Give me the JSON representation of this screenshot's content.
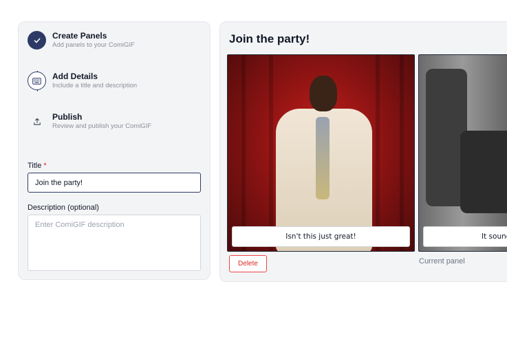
{
  "steps": [
    {
      "title": "Create Panels",
      "description": "Add panels to your ComiGIF",
      "icon": "check-icon",
      "state": "done"
    },
    {
      "title": "Add Details",
      "description": "Include a title and description",
      "icon": "keyboard-icon",
      "state": "current"
    },
    {
      "title": "Publish",
      "description": "Review and publish your ComiGIF",
      "icon": "upload-icon",
      "state": "todo"
    }
  ],
  "form": {
    "title_label": "Title",
    "title_required_marker": "*",
    "title_value": "Join the party!",
    "description_label": "Description (optional)",
    "description_placeholder": "Enter ComiGIF description",
    "description_value": ""
  },
  "preview": {
    "heading": "Join the party!",
    "panels": [
      {
        "caption": "Isn't this just great!"
      },
      {
        "caption": "It sounds"
      }
    ],
    "delete_label": "Delete",
    "current_panel_label": "Current panel"
  },
  "colors": {
    "accent": "#2d3a66",
    "danger": "#dc2626",
    "panel_bg": "#f3f4f6"
  }
}
